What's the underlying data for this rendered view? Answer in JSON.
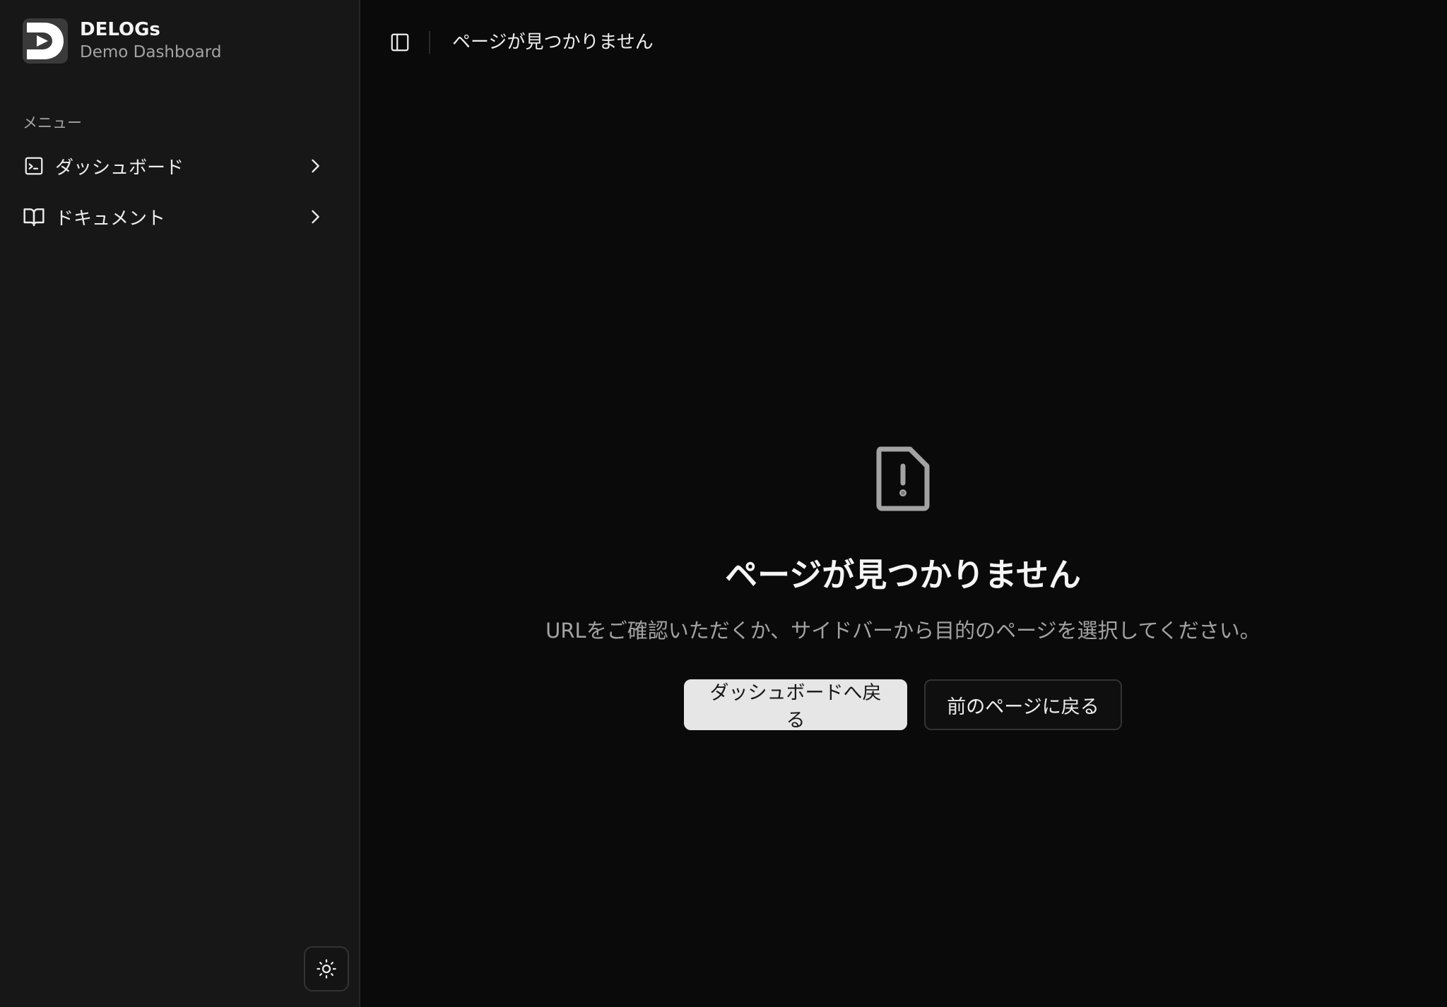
{
  "brand": {
    "name": "DELOGs",
    "subtitle": "Demo Dashboard"
  },
  "sidebar": {
    "menu_label": "メニュー",
    "items": [
      {
        "label": "ダッシュボード",
        "icon": "terminal-square-icon"
      },
      {
        "label": "ドキュメント",
        "icon": "book-open-icon"
      }
    ],
    "theme_toggle_icon": "sun-icon"
  },
  "header": {
    "title": "ページが見つかりません",
    "toggle_icon": "panel-left-icon"
  },
  "main": {
    "icon": "file-warning-icon",
    "title": "ページが見つかりません",
    "description": "URLをご確認いただくか、サイドバーから目的のページを選択してください。",
    "primary_button": "ダッシュボードへ戻る",
    "secondary_button": "前のページに戻る"
  },
  "colors": {
    "background": "#0a0a0a",
    "sidebar": "#171717",
    "primary_button": "#e6e6e6",
    "muted_text": "#a3a3a3"
  }
}
